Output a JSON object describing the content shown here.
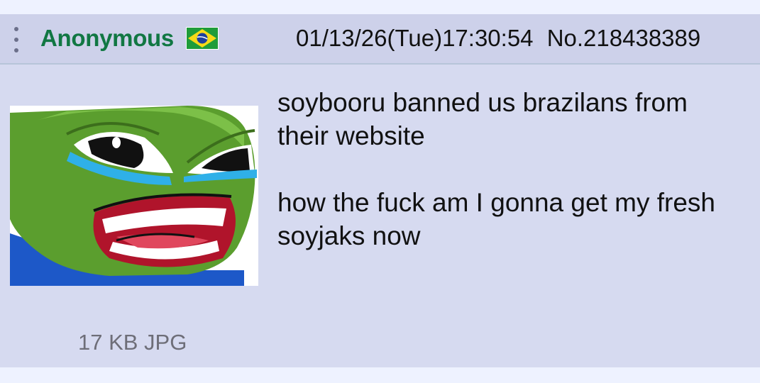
{
  "post": {
    "name": "Anonymous",
    "flag": "brazil-flag-icon",
    "datetime": "01/13/26(Tue)17:30:54",
    "number": "No.218438389",
    "file": {
      "info": "17 KB JPG",
      "thumbnail": "crying-angry-pepe-frog"
    },
    "comment": {
      "paragraph1": "soybooru banned us brazilans from their website",
      "paragraph2": "how the fuck am I gonna get my fresh soyjaks now"
    }
  },
  "colors": {
    "page_bg": "#eef2ff",
    "post_bg": "#d6daf0",
    "header_bg": "#cdd1ea",
    "name": "#117743",
    "text": "#111111",
    "file_info": "#6e6e78"
  }
}
